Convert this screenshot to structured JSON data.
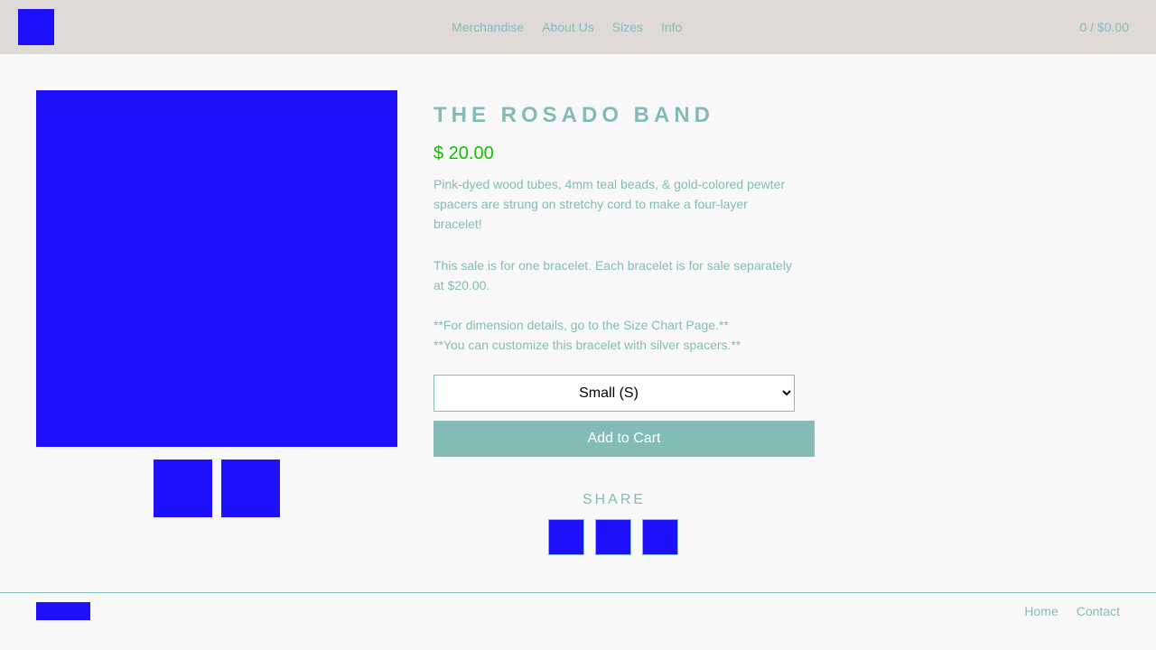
{
  "header": {
    "nav": [
      "Merchandise",
      "About Us",
      "Sizes",
      "Info"
    ],
    "cart": "0 / $0.00"
  },
  "product": {
    "title": "THE ROSADO BAND",
    "price": "$ 20.00",
    "desc1_line1": "Pink-dyed wood tubes, 4mm teal beads, & gold-colored pewter",
    "desc1_line2": "spacers are strung on stretchy cord to make a four-layer",
    "desc1_line3": "bracelet!",
    "desc2_line1": "This sale is for one bracelet. Each bracelet is for sale separately",
    "desc2_line2": "at $20.00.",
    "desc3_line1": "**For dimension details, go to the Size Chart Page.**",
    "desc3_line2": "**You can customize this bracelet with silver spacers.**",
    "size_selected": "Small (S)",
    "add_to_cart": "Add to Cart"
  },
  "share": {
    "label": "SHARE"
  },
  "footer": {
    "links": [
      "Home",
      "Contact"
    ]
  },
  "colors": {
    "accent": "#85bbb7",
    "placeholder": "#1e10fa",
    "price": "#10c000",
    "header_bg": "#dfdad7"
  }
}
